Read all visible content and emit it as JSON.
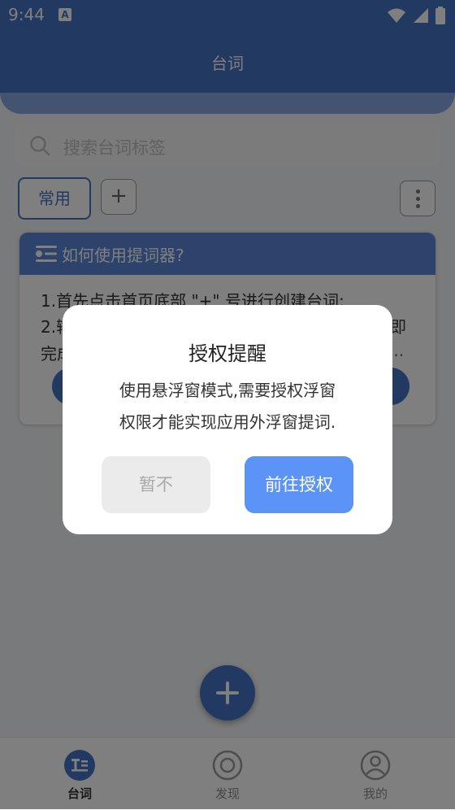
{
  "status_bar": {
    "time": "9:44",
    "notification_badge": "A"
  },
  "header": {
    "title": "台词"
  },
  "search": {
    "placeholder": "搜索台词标签"
  },
  "tags": {
    "active_tag": "常用",
    "add_label": "+"
  },
  "tutorial_card": {
    "title": "如何使用提词器?",
    "line1": "1.首先点击首页底部 \"+\" 号进行创建台词;",
    "line2": "2.输",
    "line2_end": "即",
    "line3": "完成",
    "line3_end": "..."
  },
  "fab": {
    "icon": "plus-icon"
  },
  "bottom_nav": [
    {
      "label": "台词",
      "icon": "script-icon",
      "active": true
    },
    {
      "label": "发现",
      "icon": "discover-icon",
      "active": false
    },
    {
      "label": "我的",
      "icon": "profile-icon",
      "active": false
    }
  ],
  "dialog": {
    "title": "授权提醒",
    "message_line1": "使用悬浮窗模式,需要授权浮窗",
    "message_line2": "权限才能实现应用外浮窗提词.",
    "cancel_label": "暂不",
    "confirm_label": "前往授权"
  },
  "colors": {
    "primary": "#4472c4",
    "dialog_confirm": "#5b93f6",
    "dialog_cancel_bg": "#ebebeb"
  }
}
